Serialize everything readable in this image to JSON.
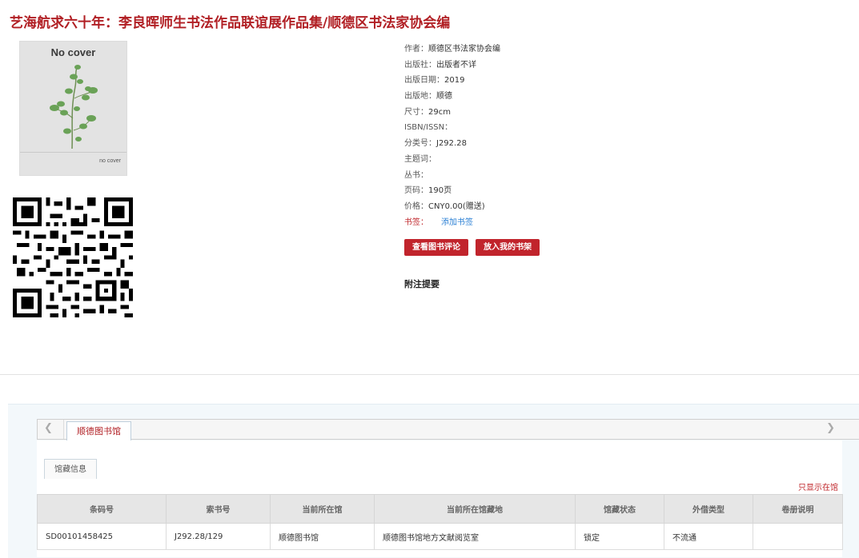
{
  "book": {
    "title": "艺海航求六十年：李良晖师生书法作品联谊展作品集/顺德区书法家协会编",
    "cover_top_text": "No cover",
    "cover_bottom_text": "no cover"
  },
  "meta": [
    {
      "label": "作者：",
      "value": "顺德区书法家协会编"
    },
    {
      "label": "出版社：",
      "value": "出版者不详"
    },
    {
      "label": "出版日期：",
      "value": "2019"
    },
    {
      "label": "出版地：",
      "value": "顺德"
    },
    {
      "label": "尺寸：",
      "value": "29cm"
    },
    {
      "label": "ISBN/ISSN：",
      "value": ""
    },
    {
      "label": "分类号：",
      "value": "J292.28"
    },
    {
      "label": "主题词：",
      "value": ""
    },
    {
      "label": "丛书：",
      "value": ""
    },
    {
      "label": "页码：",
      "value": "190页"
    },
    {
      "label": "价格：",
      "value": "CNY0.00(赠送)"
    }
  ],
  "bookmark": {
    "label": "书签：",
    "link": "添加书签"
  },
  "actions": {
    "review": "查看图书评论",
    "shelf": "放入我的书架"
  },
  "notes_title": "附注提要",
  "holdings": {
    "tab": "顺德图书馆",
    "subtab": "馆藏信息",
    "only_show": "只显示在馆",
    "headers": [
      "条码号",
      "索书号",
      "当前所在馆",
      "当前所在馆藏地",
      "馆藏状态",
      "外借类型",
      "卷册说明"
    ],
    "rows": [
      [
        "SD00101458425",
        "J292.28/129",
        "顺德图书馆",
        "顺德图书馆地方文献阅览室",
        "锁定",
        "不流通",
        ""
      ]
    ]
  },
  "colors": {
    "accent": "#b11f24",
    "button": "#c1242c",
    "link": "#2a7fd4"
  },
  "icons": {
    "prev": "chevron-left-icon",
    "next": "chevron-right-icon",
    "qr": "qr-code"
  }
}
